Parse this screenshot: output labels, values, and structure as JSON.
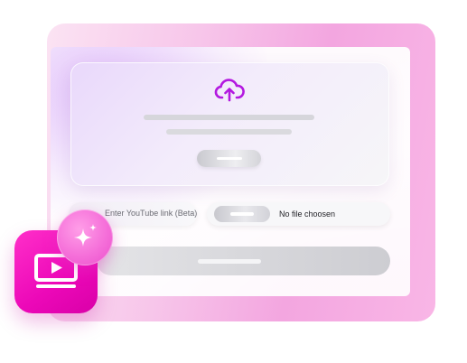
{
  "youtube_input": {
    "placeholder": "Enter YouTube link (Beta)"
  },
  "file_picker": {
    "status": "No file choosen"
  },
  "icons": {
    "upload": "cloud-upload-icon",
    "app": "video-player-icon",
    "badge": "sparkle-icon"
  },
  "colors": {
    "accent": "#b318e0",
    "brand_pink": "#ec08b8",
    "frame_pink": "#f3a6e0"
  }
}
